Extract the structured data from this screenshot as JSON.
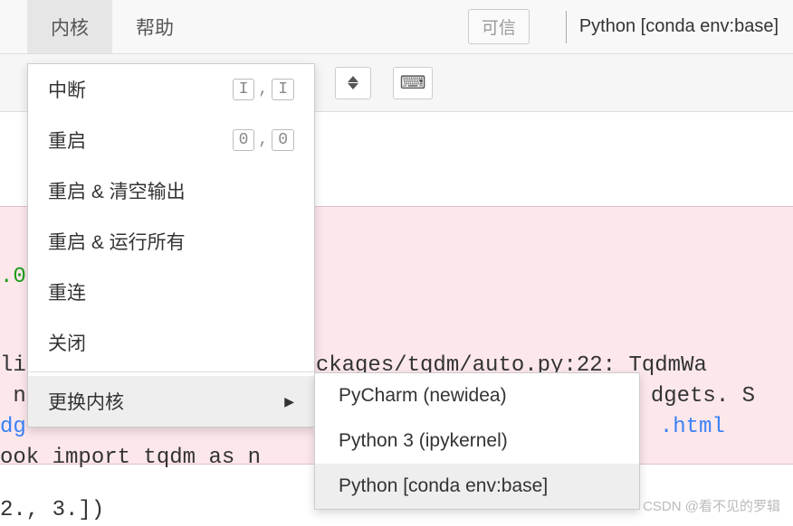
{
  "menubar": {
    "kernel": "内核",
    "help": "帮助",
    "trusted": "可信",
    "kernel_indicator": "Python [conda env:base]"
  },
  "dropdown": {
    "interrupt": "中断",
    "interrupt_key1": "I",
    "interrupt_key2": "I",
    "restart": "重启",
    "restart_key1": "0",
    "restart_key2": "0",
    "restart_clear": "重启 & 清空输出",
    "restart_run_all": "重启 & 运行所有",
    "reconnect": "重连",
    "shutdown": "关闭",
    "change_kernel": "更换内核"
  },
  "submenu": {
    "k1": "PyCharm (newidea)",
    "k2": "Python 3 (ipykernel)",
    "k3": "Python [conda env:base]"
  },
  "code": {
    "line1_a": ".0",
    "line2": "li",
    "line3": " n",
    "line4a": "dg",
    "line5": "ook import tqdm as n",
    "line6": "2., 3.])",
    "out_a": "ckages/tqdm/auto.py:22: TqdmWa",
    "out_b": "dgets. S",
    "out_link": ".html"
  },
  "watermark": "CSDN @看不见的罗辑"
}
